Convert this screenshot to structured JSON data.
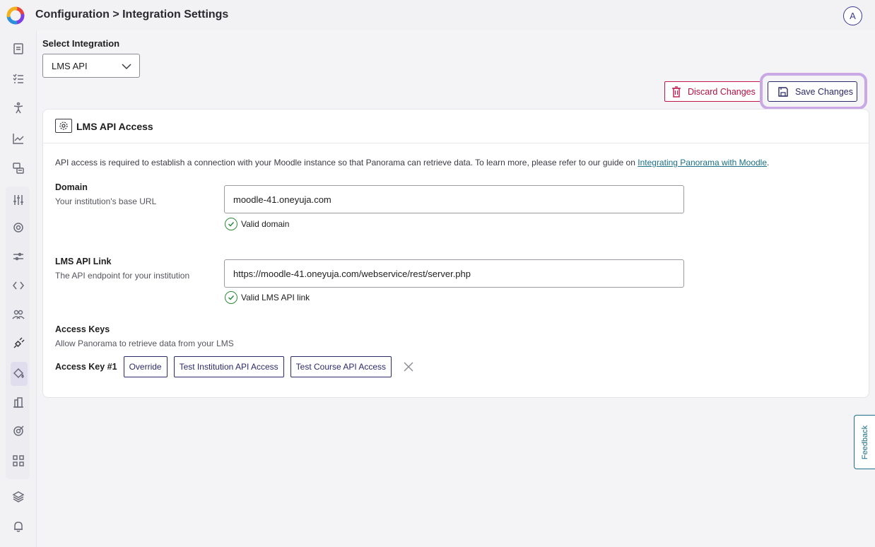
{
  "header": {
    "breadcrumb": "Configuration > Integration Settings",
    "avatar_initial": "A"
  },
  "sidebar": {
    "items": [
      {
        "icon": "document-icon"
      },
      {
        "icon": "checklist-icon"
      },
      {
        "icon": "accessibility-icon"
      },
      {
        "icon": "line-chart-icon"
      },
      {
        "icon": "reports-icon"
      },
      {
        "icon": "sliders-icon"
      },
      {
        "icon": "gear-icon"
      },
      {
        "icon": "adjustments-icon"
      },
      {
        "icon": "code-icon"
      },
      {
        "icon": "users-icon"
      },
      {
        "icon": "plug-icon",
        "active": true
      },
      {
        "icon": "paint-bucket-icon"
      },
      {
        "icon": "institution-icon"
      },
      {
        "icon": "target-icon"
      },
      {
        "icon": "grid-icon"
      },
      {
        "icon": "layers-icon"
      },
      {
        "icon": "bell-icon"
      }
    ]
  },
  "integration": {
    "label": "Select Integration",
    "selected": "LMS API"
  },
  "actions": {
    "discard_label": "Discard Changes",
    "save_label": "Save Changes"
  },
  "card": {
    "title": "LMS API Access",
    "intro_text": "API access is required to establish a connection with your Moodle instance so that Panorama can retrieve data. To learn more, please refer to our guide on ",
    "intro_link": "Integrating Panorama with Moodle",
    "intro_end": ".",
    "domain": {
      "title": "Domain",
      "subtitle": "Your institution's base URL",
      "value": "moodle-41.oneyuja.com",
      "status": "Valid domain"
    },
    "api_link": {
      "title": "LMS API Link",
      "subtitle": "The API endpoint for your institution",
      "value": "https://moodle-41.oneyuja.com/webservice/rest/server.php",
      "status": "Valid LMS API link"
    },
    "access_keys": {
      "title": "Access Keys",
      "subtitle": "Allow Panorama to retrieve data from your LMS",
      "key_label": "Access Key #1",
      "override_label": "Override",
      "test_institution_label": "Test Institution API Access",
      "test_course_label": "Test Course API Access"
    }
  },
  "feedback_label": "Feedback",
  "colors": {
    "primary": "#2b2a6a",
    "danger": "#c0184a",
    "success": "#2e8a3e",
    "link": "#1b6f86",
    "focus_ring": "#c8a9e6"
  }
}
